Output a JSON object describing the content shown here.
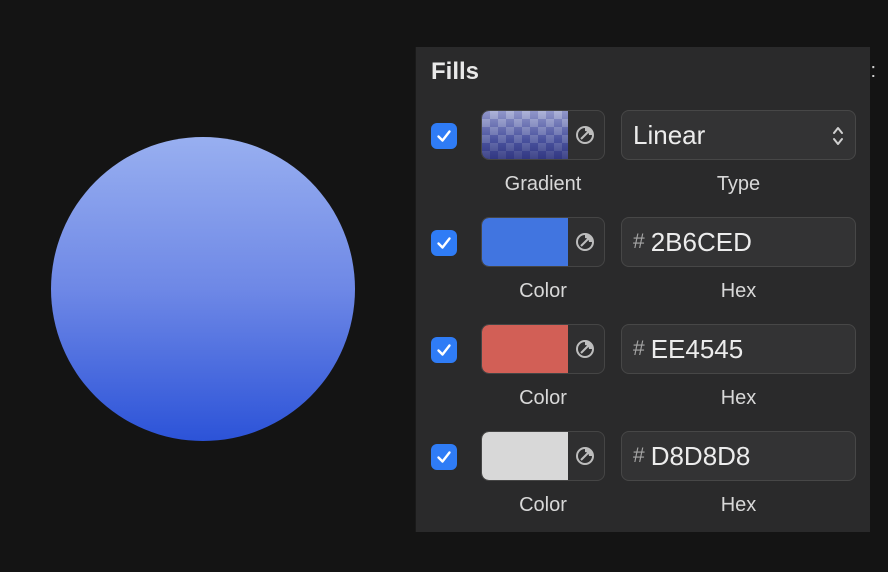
{
  "canvas": {
    "shape": {
      "gradient_top": "#98aff0",
      "gradient_mid": "#6e88e6",
      "gradient_bottom": "#2c53d8"
    }
  },
  "panel": {
    "title": "Fills",
    "more_glyph": ":"
  },
  "fills": [
    {
      "enabled": true,
      "swatch_kind": "gradient",
      "swatch_label": "Gradient",
      "value": "Linear",
      "value_label": "Type",
      "is_select": true
    },
    {
      "enabled": true,
      "swatch_kind": "color",
      "swatch_color": "#4175e0",
      "swatch_label": "Color",
      "hash": "#",
      "value": "2B6CED",
      "value_label": "Hex",
      "is_select": false
    },
    {
      "enabled": true,
      "swatch_kind": "color",
      "swatch_color": "#d25f56",
      "swatch_label": "Color",
      "hash": "#",
      "value": "EE4545",
      "value_label": "Hex",
      "is_select": false
    },
    {
      "enabled": true,
      "swatch_kind": "color",
      "swatch_color": "#d8d8d8",
      "swatch_label": "Color",
      "hash": "#",
      "value": "D8D8D8",
      "value_label": "Hex",
      "is_select": false
    }
  ],
  "colors": {
    "accent": "#2f7cf6",
    "background": "#141414",
    "panel": "#2a2a2b"
  },
  "icons": {
    "checkbox": "checkmark-icon",
    "blend": "blend-mode-icon",
    "select": "up-down-chevron-icon"
  }
}
